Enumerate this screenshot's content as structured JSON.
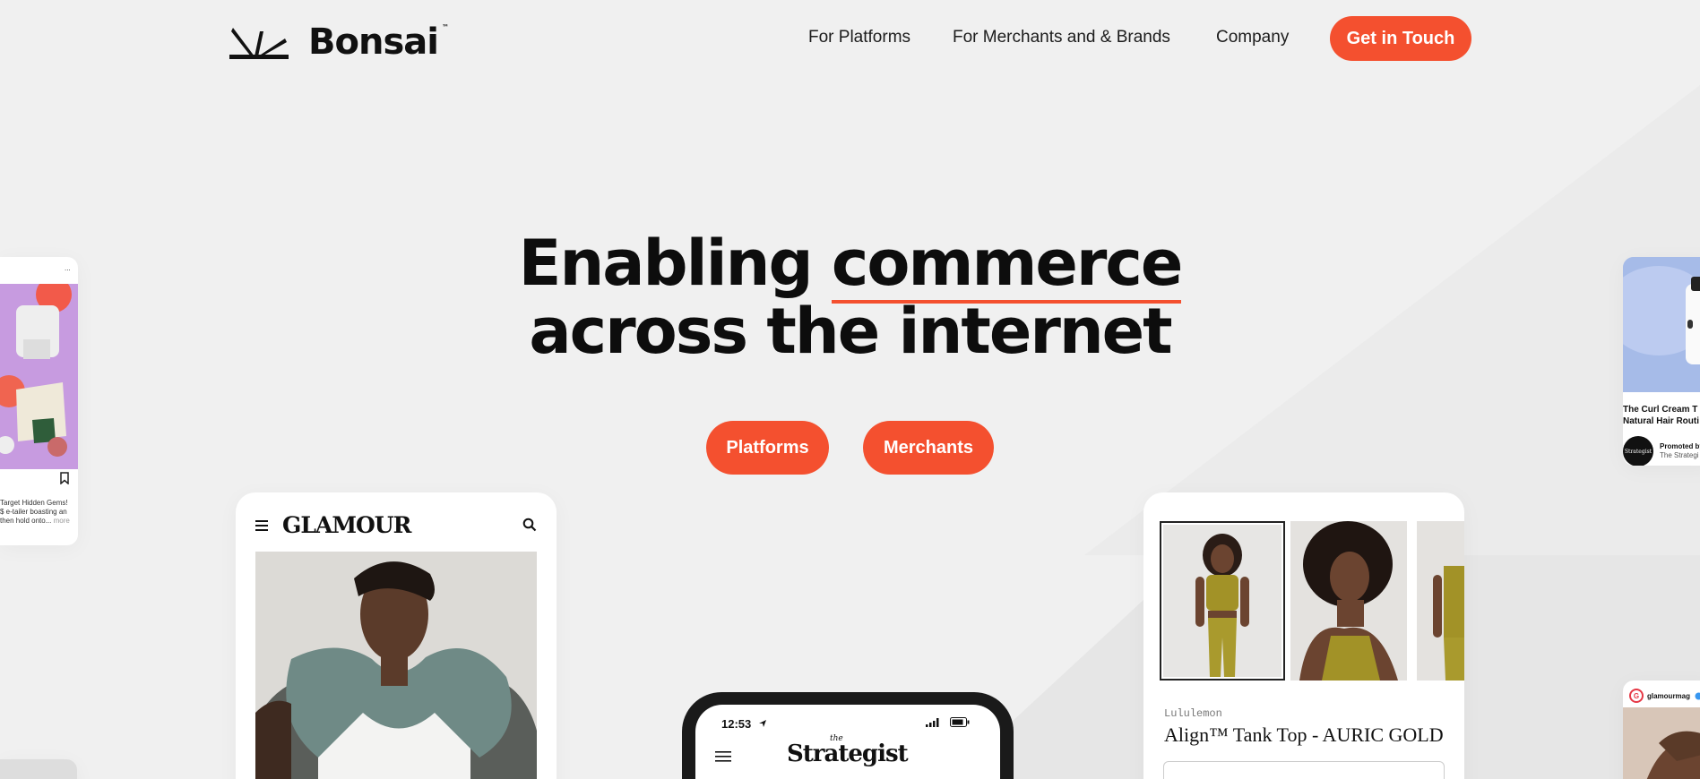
{
  "brand": {
    "name": "Bonsai",
    "tm": "™"
  },
  "nav": {
    "links": [
      "For Platforms",
      "For Merchants and & Brands",
      "Company"
    ],
    "cta": "Get in Touch"
  },
  "hero": {
    "line1_a": "Enabling ",
    "line1_b": "commerce",
    "line2": "across the internet",
    "buttons": [
      "Platforms",
      "Merchants"
    ]
  },
  "glamour_card": {
    "logo": "GLAMOUR"
  },
  "phone": {
    "time": "12:53",
    "the": "the",
    "publication": "Strategist"
  },
  "lulu_card": {
    "brand": "Lululemon",
    "product": "Align™ Tank Top - AURIC GOLD"
  },
  "left_card": {
    "menu": "...",
    "caption_1": "Target Hidden Gems!",
    "caption_2": "$ e-tailer boasting an",
    "caption_3": "then hold onto...",
    "more": "more"
  },
  "right_card": {
    "title_1": "The Curl Cream T",
    "title_2": "Natural Hair Routi",
    "promoted": "Promoted by",
    "promoter": "The Strategi",
    "avatar": "Strategist"
  },
  "right_card_2": {
    "handle": "glamourmag"
  },
  "colors": {
    "accent": "#f4502f",
    "background": "#f0f0f0",
    "text": "#111111"
  }
}
